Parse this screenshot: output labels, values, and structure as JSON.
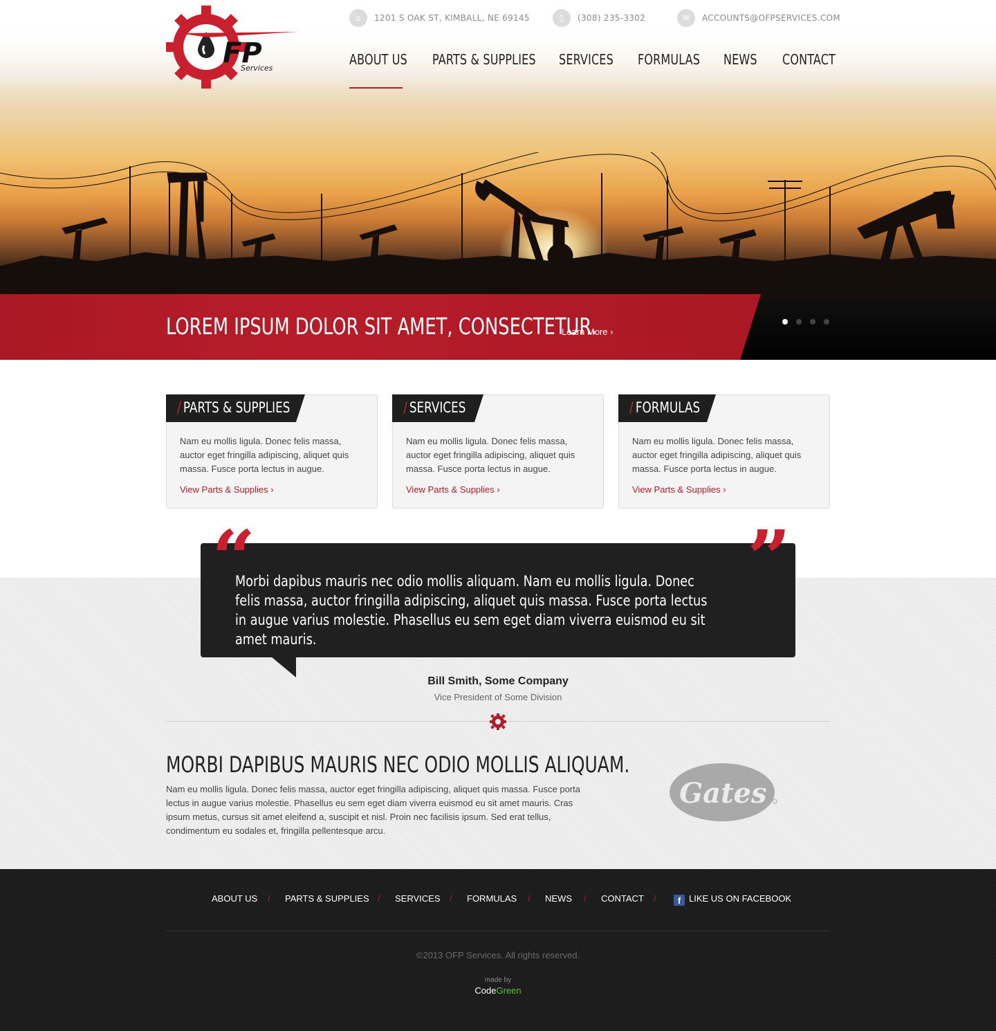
{
  "header": {
    "logo_text": "FP",
    "logo_subtext": "Services",
    "contact": {
      "address": "1201 S OAK ST, KIMBALL, NE 69145",
      "phone": "(308) 235-3302",
      "email": "ACCOUNTS@OFPSERVICES.COM",
      "address_icon": "home-icon",
      "phone_icon": "phone-icon",
      "email_icon": "envelope-icon"
    },
    "nav": [
      {
        "label": "ABOUT US",
        "active": true
      },
      {
        "label": "PARTS & SUPPLIES",
        "active": false
      },
      {
        "label": "SERVICES",
        "active": false
      },
      {
        "label": "FORMULAS",
        "active": false
      },
      {
        "label": "NEWS",
        "active": false
      },
      {
        "label": "CONTACT",
        "active": false
      }
    ]
  },
  "hero": {
    "title": "LOREM IPSUM DOLOR SIT AMET, CONSECTETUR.",
    "cta": "Learn More ›",
    "slides": 4,
    "active_slide": 1
  },
  "features": [
    {
      "title": "PARTS & SUPPLIES",
      "text": "Nam eu mollis ligula. Donec felis massa, auctor eget fringilla adipiscing, aliquet quis massa. Fusce porta lectus in augue.",
      "link": "View Parts & Supplies ›"
    },
    {
      "title": "SERVICES",
      "text": "Nam eu mollis ligula. Donec felis massa, auctor eget fringilla adipiscing, aliquet quis massa. Fusce porta lectus in augue.",
      "link": "View Parts & Supplies  ›"
    },
    {
      "title": "FORMULAS",
      "text": "Nam eu mollis ligula. Donec felis massa, auctor eget fringilla adipiscing, aliquet quis massa. Fusce porta lectus in augue.",
      "link": "View Parts & Supplies ›"
    }
  ],
  "feature_slash": "/",
  "testimonial": {
    "quote": "Morbi dapibus mauris nec odio mollis aliquam. Nam eu mollis ligula. Donec felis massa, auctor fringilla adipiscing, aliquet quis massa. Fusce porta lectus in augue varius molestie. Phasellus eu sem eget diam viverra euismod eu sit amet mauris.",
    "open_mark": "“",
    "close_mark": "”",
    "author": "Bill Smith, Some Company",
    "role": "Vice President of Some Division"
  },
  "about": {
    "title": "MORBI DAPIBUS MAURIS NEC ODIO MOLLIS ALIQUAM.",
    "text": "Nam eu mollis ligula. Donec felis massa, auctor eget fringilla adipiscing, aliquet quis massa. Fusce porta lectus in augue varius molestie. Phasellus eu sem eget diam viverra euismod eu sit amet mauris. Cras ipsum metus, cursus sit amet eleifend a, suscipit et nisl. Proin nec facilisis ipsum. Sed erat tellus, condimentum eu sodales et, fringilla pellentesque arcu.",
    "partner_logo": "Gates"
  },
  "footer": {
    "nav": [
      "ABOUT US",
      "PARTS & SUPPLIES",
      "SERVICES",
      "FORMULAS",
      "NEWS",
      "CONTACT"
    ],
    "separator": "/",
    "facebook": "LIKE US ON FACEBOOK",
    "facebook_icon": "f",
    "copyright": "©2013 OFP Services. All rights reserved.",
    "made_by": "made by",
    "maker_prefix": "Code",
    "maker_suffix": "Green"
  },
  "colors": {
    "accent": "#b01b27",
    "dark": "#202020",
    "gray_bg": "#ebebeb",
    "footer_bg": "#1c1c1c"
  }
}
